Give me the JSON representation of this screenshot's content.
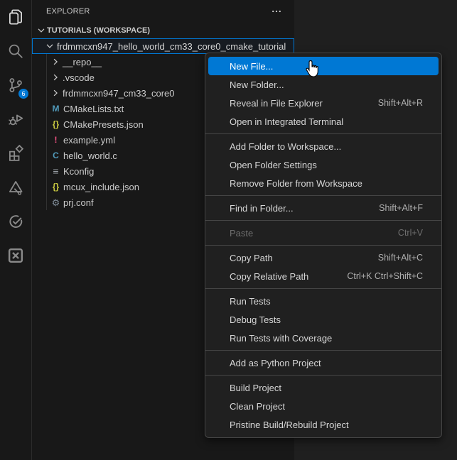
{
  "colors": {
    "accent": "#0078d4",
    "activitybar_bg": "#181818",
    "sidebar_bg": "#181818",
    "editor_bg": "#1f1f1f",
    "menu_bg": "#202020",
    "menu_border": "#454545",
    "selection_border": "#0078d4"
  },
  "activity_bar": {
    "items": [
      {
        "name": "files",
        "active": true
      },
      {
        "name": "search"
      },
      {
        "name": "source-control",
        "badge": "6"
      },
      {
        "name": "run-debug"
      },
      {
        "name": "extensions"
      },
      {
        "name": "triangle-wrench"
      },
      {
        "name": "check-circle"
      },
      {
        "name": "x-square"
      }
    ]
  },
  "sidebar": {
    "title": "EXPLORER",
    "section_label": "TUTORIALS (WORKSPACE)",
    "selected_folder": "frdmmcxn947_hello_world_cm33_core0_cmake_tutorial",
    "tree": [
      {
        "label": "__repo__",
        "kind": "folder"
      },
      {
        "label": ".vscode",
        "kind": "folder"
      },
      {
        "label": "frdmmcxn947_cm33_core0",
        "kind": "folder"
      },
      {
        "label": "CMakeLists.txt",
        "kind": "file",
        "glyph": "M",
        "glyph_color": "#519aba",
        "icon": "cmake-file-icon"
      },
      {
        "label": "CMakePresets.json",
        "kind": "file",
        "glyph": "{}",
        "glyph_color": "#cbcb41",
        "icon": "json-file-icon"
      },
      {
        "label": "example.yml",
        "kind": "file",
        "glyph": "!",
        "glyph_color": "#f55385",
        "icon": "yaml-file-icon"
      },
      {
        "label": "hello_world.c",
        "kind": "file",
        "glyph": "C",
        "glyph_color": "#519aba",
        "icon": "c-file-icon"
      },
      {
        "label": "Kconfig",
        "kind": "file",
        "glyph": "≡",
        "glyph_color": "#9aa0a6",
        "icon": "list-file-icon",
        "style": "list"
      },
      {
        "label": "mcux_include.json",
        "kind": "file",
        "glyph": "{}",
        "glyph_color": "#cbcb41",
        "icon": "json-file-icon"
      },
      {
        "label": "prj.conf",
        "kind": "file",
        "glyph": "⚙",
        "glyph_color": "#7f8c98",
        "icon": "gear-file-icon",
        "style": "gear"
      }
    ]
  },
  "context_menu": {
    "groups": [
      {
        "items": [
          {
            "label": "New File...",
            "highlighted": true
          },
          {
            "label": "New Folder..."
          },
          {
            "label": "Reveal in File Explorer",
            "shortcut": "Shift+Alt+R"
          },
          {
            "label": "Open in Integrated Terminal"
          }
        ]
      },
      {
        "items": [
          {
            "label": "Add Folder to Workspace..."
          },
          {
            "label": "Open Folder Settings"
          },
          {
            "label": "Remove Folder from Workspace"
          }
        ]
      },
      {
        "items": [
          {
            "label": "Find in Folder...",
            "shortcut": "Shift+Alt+F"
          }
        ]
      },
      {
        "items": [
          {
            "label": "Paste",
            "shortcut": "Ctrl+V",
            "disabled": true
          }
        ]
      },
      {
        "items": [
          {
            "label": "Copy Path",
            "shortcut": "Shift+Alt+C"
          },
          {
            "label": "Copy Relative Path",
            "shortcut": "Ctrl+K Ctrl+Shift+C"
          }
        ]
      },
      {
        "items": [
          {
            "label": "Run Tests"
          },
          {
            "label": "Debug Tests"
          },
          {
            "label": "Run Tests with Coverage"
          }
        ]
      },
      {
        "items": [
          {
            "label": "Add as Python Project"
          }
        ]
      },
      {
        "items": [
          {
            "label": "Build Project"
          },
          {
            "label": "Clean Project"
          },
          {
            "label": "Pristine Build/Rebuild Project"
          }
        ]
      }
    ]
  }
}
